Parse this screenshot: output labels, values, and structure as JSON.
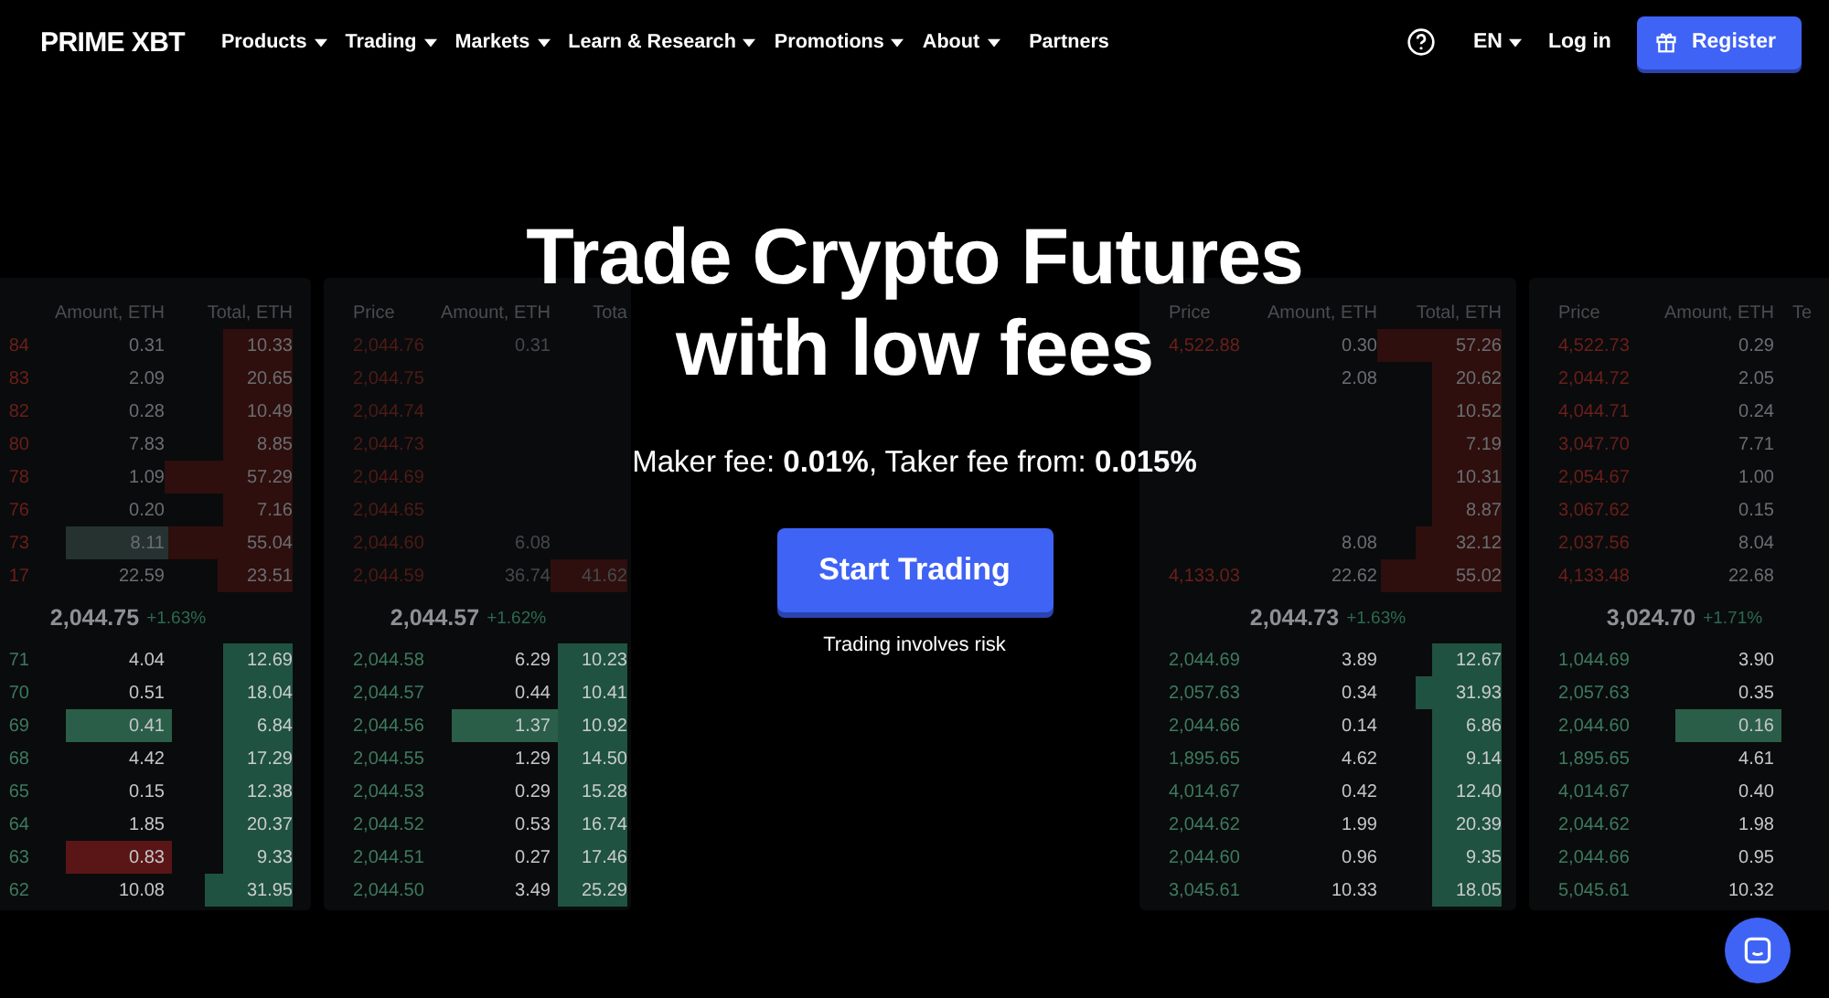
{
  "nav": {
    "logo": "PRIME XBT",
    "items": [
      {
        "label": "Products",
        "dropdown": true
      },
      {
        "label": "Trading",
        "dropdown": true
      },
      {
        "label": "Markets",
        "dropdown": true
      },
      {
        "label": "Learn & Research",
        "dropdown": true
      },
      {
        "label": "Promotions",
        "dropdown": true
      },
      {
        "label": "About",
        "dropdown": true
      },
      {
        "label": "Partners",
        "dropdown": false
      }
    ],
    "language": "EN",
    "login": "Log in",
    "register": "Register"
  },
  "hero": {
    "title_lines": [
      "Trade Crypto Futures",
      "with low fees"
    ],
    "subtitle": "Maker fee: **0.01%**, Taker fee from: **0.015%**",
    "button": "Start Trading",
    "note": "Trading involves risk"
  },
  "order_books": [
    {
      "header": {
        "amount": "Amount, ETH",
        "total": "Total, ETH"
      },
      "asks": [
        {
          "price": "84",
          "amount": "0.31",
          "total": "10.33"
        },
        {
          "price": "83",
          "amount": "2.09",
          "total": "20.65"
        },
        {
          "price": "82",
          "amount": "0.28",
          "total": "10.49"
        },
        {
          "price": "80",
          "amount": "7.83",
          "total": "8.85"
        },
        {
          "price": "78",
          "amount": "1.09",
          "total": "57.29"
        },
        {
          "price": "76",
          "amount": "0.20",
          "total": "7.16"
        },
        {
          "price": "73",
          "amount": "8.11",
          "total": "55.04",
          "color": "#253230"
        },
        {
          "price": "17",
          "amount": "22.59",
          "total": "23.51"
        }
      ],
      "mid": {
        "price": "2,044.75",
        "change": "+1.63%"
      },
      "bids": [
        {
          "price": "71",
          "amount": "4.04",
          "total": "12.69"
        },
        {
          "price": "70",
          "amount": "0.51",
          "total": "18.04"
        },
        {
          "price": "69",
          "amount": "0.41",
          "total": "6.84",
          "color": "#2a5e48"
        },
        {
          "price": "68",
          "amount": "4.42",
          "total": "17.29"
        },
        {
          "price": "65",
          "amount": "0.15",
          "total": "12.38"
        },
        {
          "price": "64",
          "amount": "1.85",
          "total": "20.37"
        },
        {
          "price": "63",
          "amount": "0.83",
          "total": "9.33",
          "color": "#5a1616"
        },
        {
          "price": "62",
          "amount": "10.08",
          "total": "31.95"
        }
      ]
    },
    {
      "header": {
        "price": "Price",
        "amount": "Amount, ETH",
        "total": "Tota"
      },
      "asks": [
        {
          "price": "2,044.76",
          "amount": "0.31"
        },
        {
          "price": "2,044.75"
        },
        {
          "price": "2,044.74"
        },
        {
          "price": "2,044.73"
        },
        {
          "price": "2,044.69"
        },
        {
          "price": "2,044.65"
        },
        {
          "price": "2,044.60",
          "amount": "6.08"
        },
        {
          "price": "2,044.59",
          "amount": "36.74",
          "total": "41.62"
        }
      ],
      "mid": {
        "price": "2,044.57",
        "change": "+1.62%"
      },
      "bids": [
        {
          "price": "2,044.58",
          "amount": "6.29",
          "total": "10.23"
        },
        {
          "price": "2,044.57",
          "amount": "0.44",
          "total": "10.41"
        },
        {
          "price": "2,044.56",
          "amount": "1.37",
          "total": "10.92",
          "color": "#2a5e48"
        },
        {
          "price": "2,044.55",
          "amount": "1.29",
          "total": "14.50"
        },
        {
          "price": "2,044.53",
          "amount": "0.29",
          "total": "15.28"
        },
        {
          "price": "2,044.52",
          "amount": "0.53",
          "total": "16.74"
        },
        {
          "price": "2,044.51",
          "amount": "0.27",
          "total": "17.46"
        },
        {
          "price": "2,044.50",
          "amount": "3.49",
          "total": "25.29"
        }
      ]
    },
    {
      "header": {
        "price": "Price",
        "amount": "Amount, ETH",
        "total": "Total, ETH"
      },
      "asks": [
        {
          "price": "4,522.88",
          "amount": "0.30",
          "total": "57.26"
        },
        {
          "amount": "2.08",
          "total": "20.62"
        },
        {
          "total": "10.52"
        },
        {
          "total": "7.19"
        },
        {
          "total": "10.31"
        },
        {
          "total": "8.87"
        },
        {
          "amount": "8.08",
          "total": "32.12"
        },
        {
          "price": "4,133.03",
          "amount": "22.62",
          "total": "55.02"
        }
      ],
      "mid": {
        "price": "2,044.73",
        "change": "+1.63%"
      },
      "bids": [
        {
          "price": "2,044.69",
          "amount": "3.89",
          "total": "12.67"
        },
        {
          "price": "2,057.63",
          "amount": "0.34",
          "total": "31.93"
        },
        {
          "price": "2,044.66",
          "amount": "0.14",
          "total": "6.86"
        },
        {
          "price": "1,895.65",
          "amount": "4.62",
          "total": "9.14"
        },
        {
          "price": "4,014.67",
          "amount": "0.42",
          "total": "12.40"
        },
        {
          "price": "2,044.62",
          "amount": "1.99",
          "total": "20.39"
        },
        {
          "price": "2,044.60",
          "amount": "0.96",
          "total": "9.35"
        },
        {
          "price": "3,045.61",
          "amount": "10.33",
          "total": "18.05"
        }
      ]
    },
    {
      "header": {
        "price": "Price",
        "amount": "Amount, ETH",
        "total": "Te"
      },
      "asks": [
        {
          "price": "4,522.73",
          "amount": "0.29"
        },
        {
          "price": "2,044.72",
          "amount": "2.05"
        },
        {
          "price": "4,044.71",
          "amount": "0.24"
        },
        {
          "price": "3,047.70",
          "amount": "7.71"
        },
        {
          "price": "2,054.67",
          "amount": "1.00"
        },
        {
          "price": "3,067.62",
          "amount": "0.15"
        },
        {
          "price": "2,037.56",
          "amount": "8.04"
        },
        {
          "price": "4,133.48",
          "amount": "22.68"
        }
      ],
      "mid": {
        "price": "3,024.70",
        "change": "+1.71%"
      },
      "bids": [
        {
          "price": "1,044.69",
          "amount": "3.90"
        },
        {
          "price": "2,057.63",
          "amount": "0.35"
        },
        {
          "price": "2,044.60",
          "amount": "0.16",
          "color": "#2a5e48"
        },
        {
          "price": "1,895.65",
          "amount": "4.61"
        },
        {
          "price": "4,014.67",
          "amount": "0.40"
        },
        {
          "price": "2,044.62",
          "amount": "1.98"
        },
        {
          "price": "2,044.66",
          "amount": "0.95"
        },
        {
          "price": "5,045.61",
          "amount": "10.32"
        }
      ]
    }
  ]
}
